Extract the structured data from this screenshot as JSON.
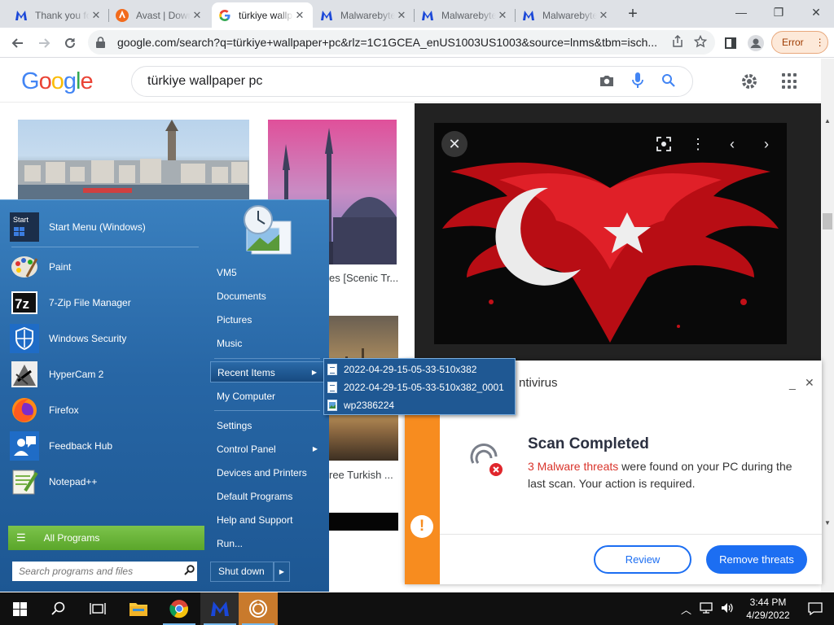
{
  "browser": {
    "tabs": [
      {
        "title": "Thank you for downloading",
        "favicon": "malwarebytes-icon",
        "active": false
      },
      {
        "title": "Avast | Download",
        "favicon": "avast-icon",
        "active": false
      },
      {
        "title": "türkiye wallpaper pc",
        "favicon": "google-icon",
        "active": true
      },
      {
        "title": "Malwarebytes",
        "favicon": "malwarebytes-icon",
        "active": false
      },
      {
        "title": "Malwarebytes",
        "favicon": "malwarebytes-icon",
        "active": false
      },
      {
        "title": "Malwarebytes",
        "favicon": "malwarebytes-icon",
        "active": false
      }
    ],
    "new_tab": "+",
    "url": "google.com/search?q=türkiye+wallpaper+pc&rlz=1C1GCEA_enUS1003US1003&source=lnms&tbm=isch...",
    "error_label": "Error",
    "window_controls": {
      "minimize": "—",
      "restore": "❐",
      "close": "✕"
    }
  },
  "google": {
    "logo": [
      "G",
      "o",
      "o",
      "g",
      "l",
      "e"
    ],
    "logo_colors": [
      "#4285f4",
      "#ea4335",
      "#fbbc05",
      "#4285f4",
      "#34a853",
      "#ea4335"
    ],
    "query": "türkiye wallpaper pc",
    "results": {
      "caption_1": "es [Scenic Tr...",
      "caption_2": "ree Turkish ..."
    }
  },
  "antivirus": {
    "title": "ntivirus",
    "minimize": "_",
    "close": "✕",
    "heading": "Scan Completed",
    "threat_count_text": "3 Malware threats",
    "body_text": " were found on your PC during the last scan. Your action is required.",
    "warn_glyph": "!",
    "review_button": "Review",
    "remove_button": "Remove threats",
    "colors": {
      "accent": "#f78c1f",
      "primary": "#1c6ef2",
      "danger": "#d9342b"
    }
  },
  "start_menu": {
    "pinned": [
      {
        "label": "Start Menu (Windows)",
        "icon": "start-menu-icon"
      },
      {
        "label": "Paint",
        "icon": "paint-icon"
      },
      {
        "label": "7-Zip File Manager",
        "icon": "7zip-icon"
      },
      {
        "label": "Windows Security",
        "icon": "windows-security-icon"
      },
      {
        "label": "HyperCam 2",
        "icon": "hypercam-icon"
      },
      {
        "label": "Firefox",
        "icon": "firefox-icon"
      },
      {
        "label": "Feedback Hub",
        "icon": "feedback-hub-icon"
      },
      {
        "label": "Notepad++",
        "icon": "notepadpp-icon"
      }
    ],
    "start_icon_text": "Start",
    "all_programs": "All Programs",
    "search_placeholder": "Search programs and files",
    "right": {
      "user": "VM5",
      "documents": "Documents",
      "pictures": "Pictures",
      "music": "Music",
      "recent_items": "Recent Items",
      "my_computer": "My Computer",
      "settings": "Settings",
      "control_panel": "Control Panel",
      "devices_printers": "Devices and Printers",
      "default_programs": "Default Programs",
      "help_support": "Help and Support",
      "run": "Run..."
    },
    "shutdown": "Shut down",
    "recent_flyout": [
      {
        "label": "2022-04-29-15-05-33-510x382",
        "icon": "document-icon"
      },
      {
        "label": "2022-04-29-15-05-33-510x382_0001",
        "icon": "document-icon"
      },
      {
        "label": "wp2386224",
        "icon": "image-file-icon"
      }
    ]
  },
  "taskbar": {
    "apps": [
      "windows-start-icon",
      "search-icon",
      "task-view-icon",
      "file-explorer-icon",
      "chrome-icon",
      "malwarebytes-icon",
      "antivirus-app-icon"
    ],
    "time": "3:44 PM",
    "date": "4/29/2022"
  }
}
